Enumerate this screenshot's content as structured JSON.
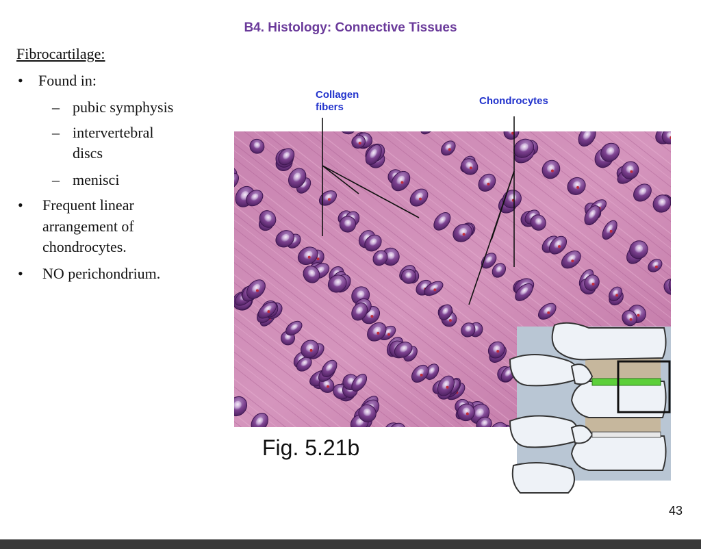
{
  "slide": {
    "title": "B4. Histology: Connective Tissues",
    "heading": "Fibrocartilage:",
    "bullets": {
      "found_in": "Found in:",
      "sub1": "pubic symphysis",
      "sub2_line1": "intervertebral",
      "sub2_line2": "discs",
      "sub3": "menisci",
      "linear_line1": "Frequent linear",
      "linear_line2": "arrangement of",
      "linear_line3": "chondrocytes.",
      "no_perichondrium": "NO perichondrium."
    },
    "bullet_char": "•",
    "dash_char": "–",
    "figure": {
      "label_collagen_line1": "Collagen",
      "label_collagen_line2": "fibers",
      "label_chondrocytes": "Chondrocytes",
      "caption": "Fig. 5.21b"
    },
    "page_number": "43"
  },
  "colors": {
    "title": "#6a3a9a",
    "figure_label": "#2233cc",
    "tissue_background": "#c77aa8",
    "cell": "#7a3e8c",
    "nucleus": "#c02a3a",
    "disc_green": "#5ccf3a"
  }
}
